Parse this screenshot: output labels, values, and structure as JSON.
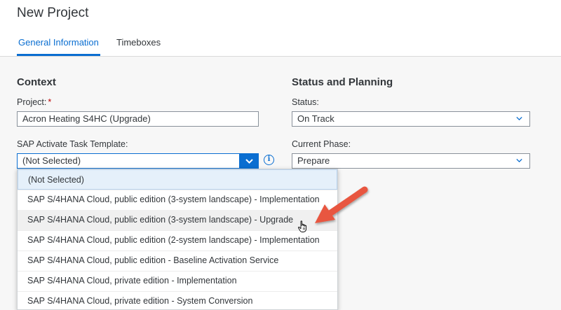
{
  "header": {
    "title": "New Project",
    "tabs": [
      {
        "label": "General Information",
        "active": true
      },
      {
        "label": "Timeboxes",
        "active": false
      }
    ]
  },
  "context": {
    "title": "Context",
    "project_label": "Project:",
    "project_required": "*",
    "project_value": "Acron Heating S4HC (Upgrade)",
    "template_label": "SAP Activate Task Template:",
    "template_value": "(Not Selected)"
  },
  "status_planning": {
    "title": "Status and Planning",
    "status_label": "Status:",
    "status_value": "On Track",
    "phase_label": "Current Phase:",
    "phase_value": "Prepare"
  },
  "dropdown": {
    "options": [
      "(Not Selected)",
      "SAP S/4HANA Cloud, public edition (3-system landscape) - Implementation",
      "SAP S/4HANA Cloud, public edition (3-system landscape) - Upgrade",
      "SAP S/4HANA Cloud, public edition (2-system landscape) - Implementation",
      "SAP S/4HANA Cloud, public edition - Baseline Activation Service",
      "SAP S/4HANA Cloud, private edition - Implementation",
      "SAP S/4HANA Cloud, private edition - System Conversion"
    ],
    "selected_index": 0,
    "hover_index": 2
  },
  "colors": {
    "accent": "#0a6ed1",
    "annotation_arrow": "#e8573f"
  }
}
